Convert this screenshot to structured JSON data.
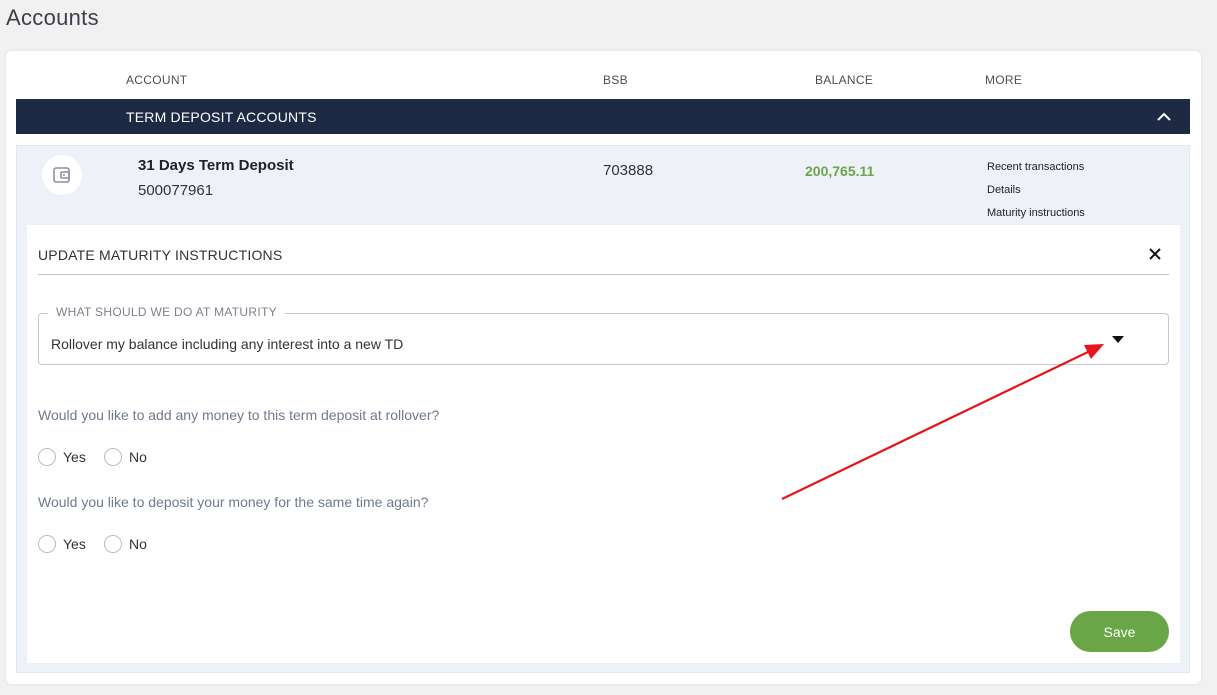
{
  "page": {
    "title": "Accounts"
  },
  "table": {
    "columns": {
      "account": "ACCOUNT",
      "bsb": "BSB",
      "balance": "BALANCE",
      "more": "MORE"
    },
    "group": {
      "label": "TERM DEPOSIT ACCOUNTS"
    },
    "account": {
      "name": "31 Days Term Deposit",
      "number": "500077961",
      "bsb": "703888",
      "balance": "200,765.11",
      "more_links": [
        "Recent transactions",
        "Details",
        "Maturity instructions"
      ]
    }
  },
  "form": {
    "title": "UPDATE MATURITY INSTRUCTIONS",
    "select": {
      "label": "WHAT SHOULD WE DO AT MATURITY",
      "value": "Rollover my balance including any interest into a new TD"
    },
    "questions": [
      {
        "text": "Would you like to add any money to this term deposit at rollover?",
        "options": [
          "Yes",
          "No"
        ]
      },
      {
        "text": "Would you like to deposit your money for the same time again?",
        "options": [
          "Yes",
          "No"
        ]
      }
    ],
    "save_label": "Save"
  },
  "colors": {
    "navy": "#1e2a44",
    "green": "#6aa648",
    "annotation_red": "#e8141a"
  }
}
